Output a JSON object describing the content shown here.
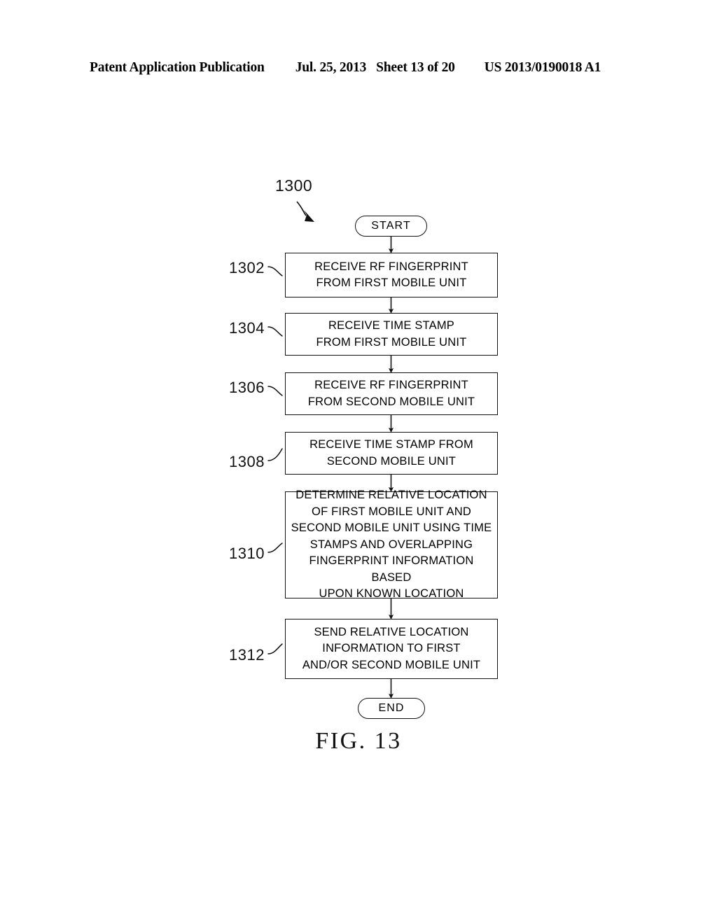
{
  "header": {
    "title": "Patent Application Publication",
    "date": "Jul. 25, 2013",
    "sheet": "Sheet 13 of 20",
    "publication_number": "US 2013/0190018 A1"
  },
  "figure": {
    "caption": "FIG. 13",
    "diagram_reference": "1300",
    "start_label": "START",
    "end_label": "END"
  },
  "steps": [
    {
      "ref": "1302",
      "lines": [
        "RECEIVE RF FINGERPRINT",
        "FROM FIRST MOBILE UNIT"
      ]
    },
    {
      "ref": "1304",
      "lines": [
        "RECEIVE TIME STAMP",
        "FROM FIRST MOBILE UNIT"
      ]
    },
    {
      "ref": "1306",
      "lines": [
        "RECEIVE RF FINGERPRINT",
        "FROM SECOND MOBILE UNIT"
      ]
    },
    {
      "ref": "1308",
      "lines": [
        "RECEIVE TIME STAMP FROM",
        "SECOND MOBILE UNIT"
      ]
    },
    {
      "ref": "1310",
      "lines": [
        "DETERMINE RELATIVE LOCATION",
        "OF FIRST MOBILE UNIT AND",
        "SECOND MOBILE UNIT USING TIME",
        "STAMPS AND OVERLAPPING",
        "FINGERPRINT INFORMATION BASED",
        "UPON KNOWN LOCATION"
      ]
    },
    {
      "ref": "1312",
      "lines": [
        "SEND RELATIVE LOCATION",
        "INFORMATION TO FIRST",
        "AND/OR SECOND MOBILE UNIT"
      ]
    }
  ],
  "colors": {
    "ink": "#111111",
    "paper": "#ffffff"
  }
}
